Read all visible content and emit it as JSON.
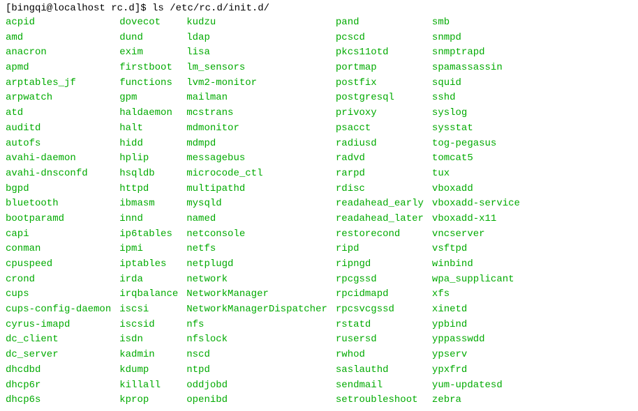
{
  "prompt": "[bingqi@localhost rc.d]$ ls /etc/rc.d/init.d/",
  "columns": [
    [
      "acpid",
      "amd",
      "anacron",
      "apmd",
      "arptables_jf",
      "arpwatch",
      "atd",
      "auditd",
      "autofs",
      "avahi-daemon",
      "avahi-dnsconfd",
      "bgpd",
      "bluetooth",
      "bootparamd",
      "capi",
      "conman",
      "cpuspeed",
      "crond",
      "cups",
      "cups-config-daemon",
      "cyrus-imapd",
      "dc_client",
      "dc_server",
      "dhcdbd",
      "dhcp6r",
      "dhcp6s"
    ],
    [
      "dovecot",
      "dund",
      "exim",
      "firstboot",
      "functions",
      "gpm",
      "haldaemon",
      "halt",
      "hidd",
      "hplip",
      "hsqldb",
      "httpd",
      "ibmasm",
      "innd",
      "ip6tables",
      "ipmi",
      "iptables",
      "irda",
      "irqbalance",
      "iscsi",
      "iscsid",
      "isdn",
      "kadmin",
      "kdump",
      "killall",
      "kprop"
    ],
    [
      "kudzu",
      "ldap",
      "lisa",
      "lm_sensors",
      "lvm2-monitor",
      "mailman",
      "mcstrans",
      "mdmonitor",
      "mdmpd",
      "messagebus",
      "microcode_ctl",
      "multipathd",
      "mysqld",
      "named",
      "netconsole",
      "netfs",
      "netplugd",
      "network",
      "NetworkManager",
      "NetworkManagerDispatcher",
      "nfs",
      "nfslock",
      "nscd",
      "ntpd",
      "oddjobd",
      "openibd"
    ],
    [
      "pand",
      "pcscd",
      "pkcs11otd",
      "portmap",
      "postfix",
      "postgresql",
      "privoxy",
      "psacct",
      "radiusd",
      "radvd",
      "rarpd",
      "rdisc",
      "readahead_early",
      "readahead_later",
      "restorecond",
      "ripd",
      "ripngd",
      "rpcgssd",
      "rpcidmapd",
      "rpcsvcgssd",
      "rstatd",
      "rusersd",
      "rwhod",
      "saslauthd",
      "sendmail",
      "setroubleshoot"
    ],
    [
      "smb",
      "snmpd",
      "snmptrapd",
      "spamassassin",
      "squid",
      "sshd",
      "syslog",
      "sysstat",
      "tog-pegasus",
      "tomcat5",
      "tux",
      "vboxadd",
      "vboxadd-service",
      "vboxadd-x11",
      "vncserver",
      "vsftpd",
      "winbind",
      "wpa_supplicant",
      "xfs",
      "xinetd",
      "ypbind",
      "yppasswdd",
      "ypserv",
      "ypxfrd",
      "yum-updatesd",
      "zebra"
    ]
  ]
}
